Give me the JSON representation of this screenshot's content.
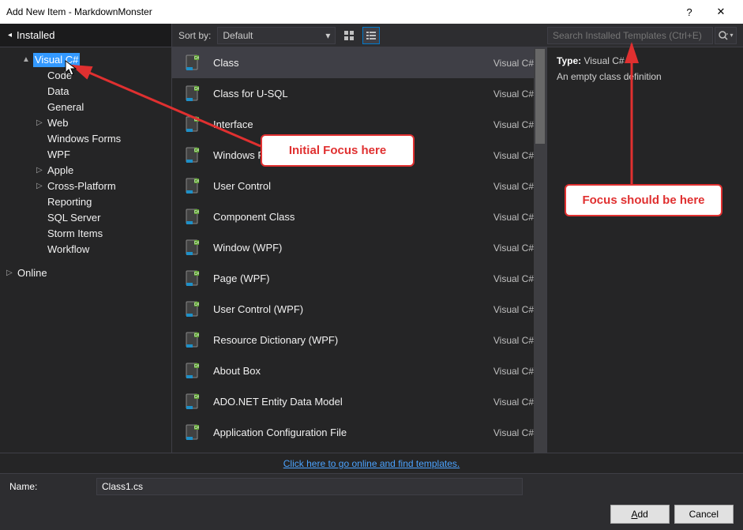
{
  "titlebar": {
    "text": "Add New Item - MarkdownMonster",
    "help": "?",
    "close": "✕"
  },
  "leftTab": "Installed",
  "sort": {
    "label": "Sort by:",
    "value": "Default"
  },
  "search": {
    "placeholder": "Search Installed Templates (Ctrl+E)"
  },
  "tree": [
    {
      "label": "Visual C#",
      "level": 1,
      "expander": "▲",
      "selected": true
    },
    {
      "label": "Code",
      "level": 2,
      "expander": ""
    },
    {
      "label": "Data",
      "level": 2,
      "expander": ""
    },
    {
      "label": "General",
      "level": 2,
      "expander": ""
    },
    {
      "label": "Web",
      "level": 2,
      "expander": "▷"
    },
    {
      "label": "Windows Forms",
      "level": 2,
      "expander": ""
    },
    {
      "label": "WPF",
      "level": 2,
      "expander": ""
    },
    {
      "label": "Apple",
      "level": 2,
      "expander": "▷"
    },
    {
      "label": "Cross-Platform",
      "level": 2,
      "expander": "▷"
    },
    {
      "label": "Reporting",
      "level": 2,
      "expander": ""
    },
    {
      "label": "SQL Server",
      "level": 2,
      "expander": ""
    },
    {
      "label": "Storm Items",
      "level": 2,
      "expander": ""
    },
    {
      "label": "Workflow",
      "level": 2,
      "expander": ""
    }
  ],
  "treeOnline": {
    "label": "Online",
    "expander": "▷"
  },
  "templates": [
    {
      "name": "Class",
      "lang": "Visual C#",
      "selected": true
    },
    {
      "name": "Class for U-SQL",
      "lang": "Visual C#"
    },
    {
      "name": "Interface",
      "lang": "Visual C#"
    },
    {
      "name": "Windows Form",
      "lang": "Visual C#"
    },
    {
      "name": "User Control",
      "lang": "Visual C#"
    },
    {
      "name": "Component Class",
      "lang": "Visual C#"
    },
    {
      "name": "Window (WPF)",
      "lang": "Visual C#"
    },
    {
      "name": "Page (WPF)",
      "lang": "Visual C#"
    },
    {
      "name": "User Control (WPF)",
      "lang": "Visual C#"
    },
    {
      "name": "Resource Dictionary (WPF)",
      "lang": "Visual C#"
    },
    {
      "name": "About Box",
      "lang": "Visual C#"
    },
    {
      "name": "ADO.NET Entity Data Model",
      "lang": "Visual C#"
    },
    {
      "name": "Application Configuration File",
      "lang": "Visual C#"
    }
  ],
  "details": {
    "typeLabel": "Type:",
    "typeValue": "Visual C#",
    "description": "An empty class definition"
  },
  "onlineLink": "Click here to go online and find templates.",
  "nameField": {
    "label": "Name:",
    "value": "Class1.cs"
  },
  "buttons": {
    "add": "Add",
    "cancel": "Cancel"
  },
  "annotations": {
    "initial": "Initial Focus here",
    "should": "Focus should be here"
  }
}
